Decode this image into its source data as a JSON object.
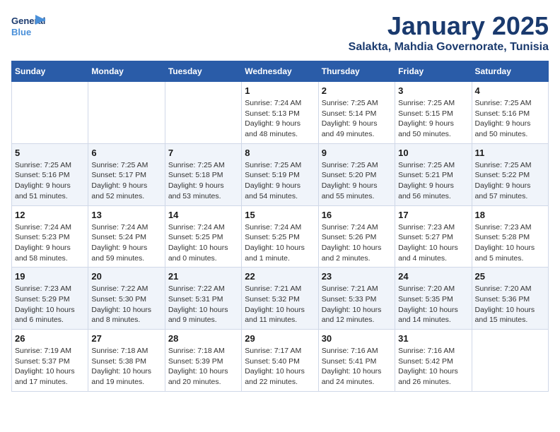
{
  "header": {
    "logo_general": "General",
    "logo_blue": "Blue",
    "title": "January 2025",
    "subtitle": "Salakta, Mahdia Governorate, Tunisia"
  },
  "weekdays": [
    "Sunday",
    "Monday",
    "Tuesday",
    "Wednesday",
    "Thursday",
    "Friday",
    "Saturday"
  ],
  "weeks": [
    [
      {
        "day": "",
        "info": ""
      },
      {
        "day": "",
        "info": ""
      },
      {
        "day": "",
        "info": ""
      },
      {
        "day": "1",
        "info": "Sunrise: 7:24 AM\nSunset: 5:13 PM\nDaylight: 9 hours\nand 48 minutes."
      },
      {
        "day": "2",
        "info": "Sunrise: 7:25 AM\nSunset: 5:14 PM\nDaylight: 9 hours\nand 49 minutes."
      },
      {
        "day": "3",
        "info": "Sunrise: 7:25 AM\nSunset: 5:15 PM\nDaylight: 9 hours\nand 50 minutes."
      },
      {
        "day": "4",
        "info": "Sunrise: 7:25 AM\nSunset: 5:16 PM\nDaylight: 9 hours\nand 50 minutes."
      }
    ],
    [
      {
        "day": "5",
        "info": "Sunrise: 7:25 AM\nSunset: 5:16 PM\nDaylight: 9 hours\nand 51 minutes."
      },
      {
        "day": "6",
        "info": "Sunrise: 7:25 AM\nSunset: 5:17 PM\nDaylight: 9 hours\nand 52 minutes."
      },
      {
        "day": "7",
        "info": "Sunrise: 7:25 AM\nSunset: 5:18 PM\nDaylight: 9 hours\nand 53 minutes."
      },
      {
        "day": "8",
        "info": "Sunrise: 7:25 AM\nSunset: 5:19 PM\nDaylight: 9 hours\nand 54 minutes."
      },
      {
        "day": "9",
        "info": "Sunrise: 7:25 AM\nSunset: 5:20 PM\nDaylight: 9 hours\nand 55 minutes."
      },
      {
        "day": "10",
        "info": "Sunrise: 7:25 AM\nSunset: 5:21 PM\nDaylight: 9 hours\nand 56 minutes."
      },
      {
        "day": "11",
        "info": "Sunrise: 7:25 AM\nSunset: 5:22 PM\nDaylight: 9 hours\nand 57 minutes."
      }
    ],
    [
      {
        "day": "12",
        "info": "Sunrise: 7:24 AM\nSunset: 5:23 PM\nDaylight: 9 hours\nand 58 minutes."
      },
      {
        "day": "13",
        "info": "Sunrise: 7:24 AM\nSunset: 5:24 PM\nDaylight: 9 hours\nand 59 minutes."
      },
      {
        "day": "14",
        "info": "Sunrise: 7:24 AM\nSunset: 5:25 PM\nDaylight: 10 hours\nand 0 minutes."
      },
      {
        "day": "15",
        "info": "Sunrise: 7:24 AM\nSunset: 5:25 PM\nDaylight: 10 hours\nand 1 minute."
      },
      {
        "day": "16",
        "info": "Sunrise: 7:24 AM\nSunset: 5:26 PM\nDaylight: 10 hours\nand 2 minutes."
      },
      {
        "day": "17",
        "info": "Sunrise: 7:23 AM\nSunset: 5:27 PM\nDaylight: 10 hours\nand 4 minutes."
      },
      {
        "day": "18",
        "info": "Sunrise: 7:23 AM\nSunset: 5:28 PM\nDaylight: 10 hours\nand 5 minutes."
      }
    ],
    [
      {
        "day": "19",
        "info": "Sunrise: 7:23 AM\nSunset: 5:29 PM\nDaylight: 10 hours\nand 6 minutes."
      },
      {
        "day": "20",
        "info": "Sunrise: 7:22 AM\nSunset: 5:30 PM\nDaylight: 10 hours\nand 8 minutes."
      },
      {
        "day": "21",
        "info": "Sunrise: 7:22 AM\nSunset: 5:31 PM\nDaylight: 10 hours\nand 9 minutes."
      },
      {
        "day": "22",
        "info": "Sunrise: 7:21 AM\nSunset: 5:32 PM\nDaylight: 10 hours\nand 11 minutes."
      },
      {
        "day": "23",
        "info": "Sunrise: 7:21 AM\nSunset: 5:33 PM\nDaylight: 10 hours\nand 12 minutes."
      },
      {
        "day": "24",
        "info": "Sunrise: 7:20 AM\nSunset: 5:35 PM\nDaylight: 10 hours\nand 14 minutes."
      },
      {
        "day": "25",
        "info": "Sunrise: 7:20 AM\nSunset: 5:36 PM\nDaylight: 10 hours\nand 15 minutes."
      }
    ],
    [
      {
        "day": "26",
        "info": "Sunrise: 7:19 AM\nSunset: 5:37 PM\nDaylight: 10 hours\nand 17 minutes."
      },
      {
        "day": "27",
        "info": "Sunrise: 7:18 AM\nSunset: 5:38 PM\nDaylight: 10 hours\nand 19 minutes."
      },
      {
        "day": "28",
        "info": "Sunrise: 7:18 AM\nSunset: 5:39 PM\nDaylight: 10 hours\nand 20 minutes."
      },
      {
        "day": "29",
        "info": "Sunrise: 7:17 AM\nSunset: 5:40 PM\nDaylight: 10 hours\nand 22 minutes."
      },
      {
        "day": "30",
        "info": "Sunrise: 7:16 AM\nSunset: 5:41 PM\nDaylight: 10 hours\nand 24 minutes."
      },
      {
        "day": "31",
        "info": "Sunrise: 7:16 AM\nSunset: 5:42 PM\nDaylight: 10 hours\nand 26 minutes."
      },
      {
        "day": "",
        "info": ""
      }
    ]
  ]
}
